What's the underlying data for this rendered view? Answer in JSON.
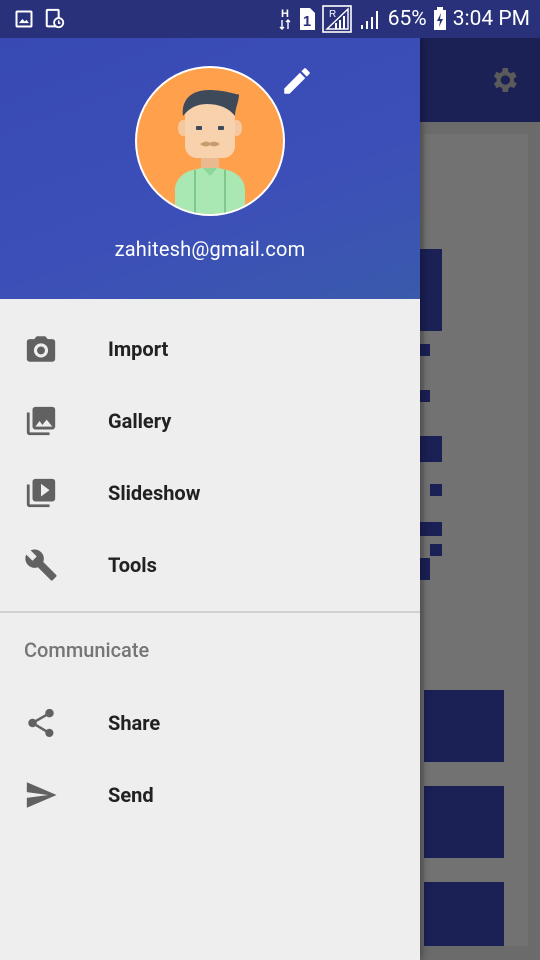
{
  "status_bar": {
    "battery": "65%",
    "time": "3:04 PM",
    "network_h": "H",
    "sim": "1",
    "roaming": "R"
  },
  "background_app": {
    "toolbar_color": "#1b2055",
    "icon": "settings-gear-icon"
  },
  "drawer": {
    "header": {
      "email": "zahitesh@gmail.com",
      "avatar": "user-avatar",
      "edit_icon": "pencil-icon"
    },
    "items": [
      {
        "label": "Import",
        "icon": "camera-icon"
      },
      {
        "label": "Gallery",
        "icon": "gallery-icon"
      },
      {
        "label": "Slideshow",
        "icon": "slideshow-icon"
      },
      {
        "label": "Tools",
        "icon": "wrench-icon"
      }
    ],
    "section": {
      "title": "Communicate",
      "items": [
        {
          "label": "Share",
          "icon": "share-icon"
        },
        {
          "label": "Send",
          "icon": "send-icon"
        }
      ]
    }
  },
  "colors": {
    "header_blue": "#3849b4",
    "status_bar": "#28317a",
    "drawer_bg": "#eeeeee",
    "icon_gray": "#5f5f5f"
  }
}
